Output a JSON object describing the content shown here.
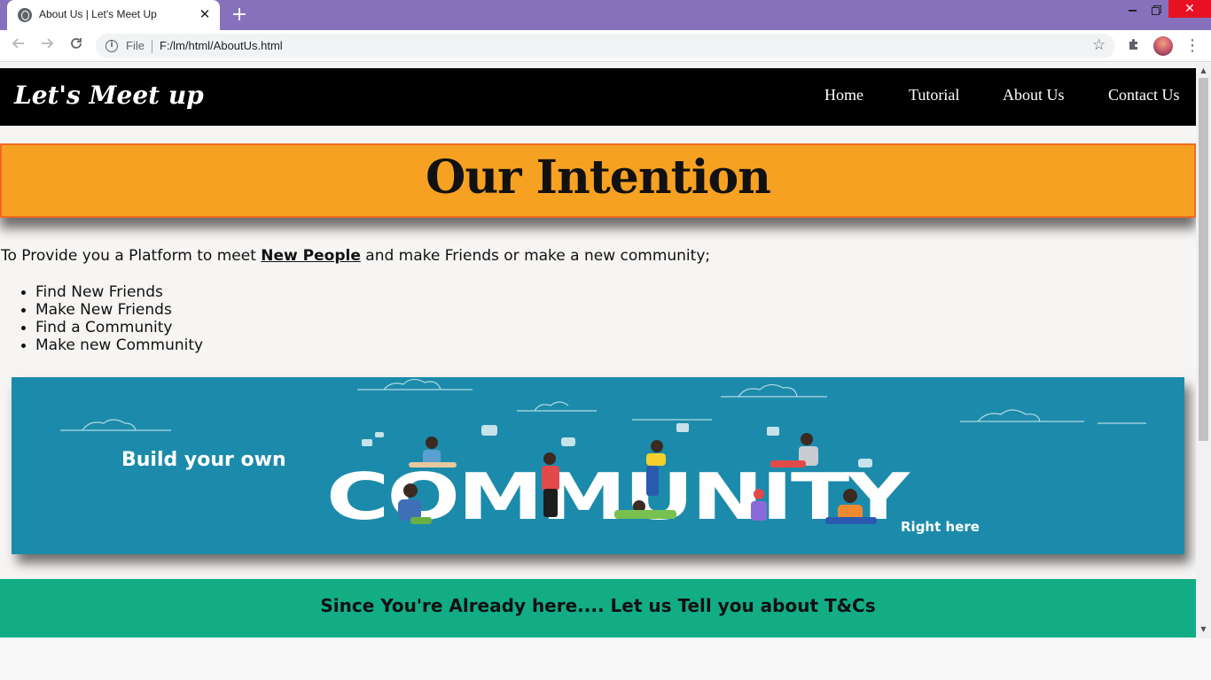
{
  "browser": {
    "tab_title": "About Us | Let's Meet Up",
    "tab_close": "✕",
    "new_tab": "+",
    "window_close": "✕",
    "omnibox_scheme": "File",
    "url": "F:/lm/html/AboutUs.html",
    "icons": {
      "back": "arrow-left-icon",
      "forward": "arrow-right-icon",
      "reload": "reload-icon",
      "info": "info-icon",
      "bookmark": "star-icon",
      "extensions": "puzzle-icon",
      "menu": "kebab-menu-icon"
    }
  },
  "site": {
    "logo": "Let's Meet up",
    "nav": {
      "home": "Home",
      "tutorial": "Tutorial",
      "about": "About Us",
      "contact": "Contact Us"
    },
    "intention": {
      "title": "Our Intention"
    },
    "intro": {
      "before": "To Provide you a Platform to meet ",
      "highlight": "New People",
      "after": " and make Friends or make a new community;"
    },
    "features": [
      "Find New Friends",
      "Make New Friends",
      "Find a Community",
      "Make new Community"
    ],
    "banner": {
      "line1": "Build your own",
      "big_word": "COMMUNITY",
      "line2": "Right here"
    },
    "tc_text": "Since You're Already here.... Let us Tell you about T&Cs"
  },
  "colors": {
    "tab_strip": "#8771bd",
    "nav_bg": "#000000",
    "intention_bg": "#f7a123",
    "intention_border": "#f06a22",
    "banner_bg": "#1c8bab",
    "tc_bg": "#12ad85"
  }
}
